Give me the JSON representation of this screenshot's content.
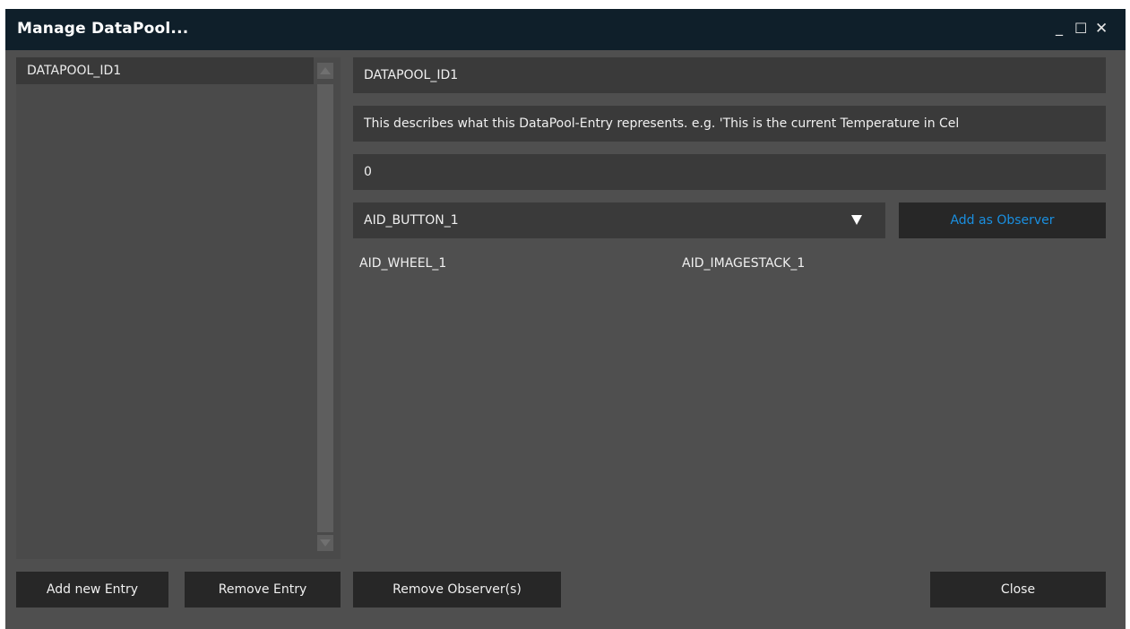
{
  "window": {
    "title": "Manage DataPool...",
    "minimize_glyph": "_",
    "maximize_glyph": "☐",
    "close_glyph": "✕"
  },
  "entries_list": {
    "items": [
      "DATAPOOL_ID1"
    ]
  },
  "details": {
    "name": "DATAPOOL_ID1",
    "description": "This describes what this DataPool-Entry represents. e.g. 'This is the current Temperature in Cel",
    "value": "0",
    "observer_select": "AID_BUTTON_1",
    "add_observer_label": "Add as Observer",
    "observers": [
      "AID_WHEEL_1",
      "AID_IMAGESTACK_1"
    ]
  },
  "buttons": {
    "add_entry": "Add new Entry",
    "remove_entry": "Remove Entry",
    "remove_observers": "Remove Observer(s)",
    "close": "Close"
  },
  "colors": {
    "titlebar": "#0f1f2a",
    "panel": "#4f4f4f",
    "field": "#3a3a3a",
    "button": "#272727",
    "accent": "#1a8fe0"
  }
}
